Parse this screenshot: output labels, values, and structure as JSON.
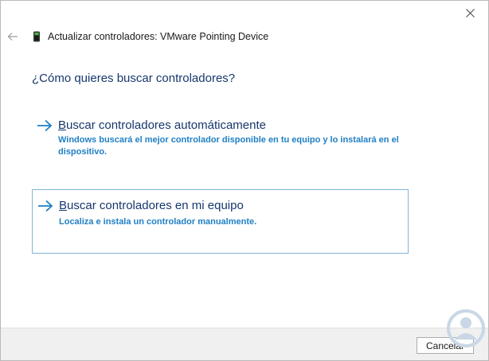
{
  "window": {
    "title": "Actualizar controladores: VMware Pointing Device"
  },
  "heading": "¿Cómo quieres buscar controladores?",
  "options": [
    {
      "title_first": "B",
      "title_rest": "uscar controladores automáticamente",
      "description": "Windows buscará el mejor controlador disponible en tu equipo y lo instalará en el dispositivo."
    },
    {
      "title_first": "B",
      "title_rest": "uscar controladores en mi equipo",
      "description": "Localiza e instala un controlador manualmente."
    }
  ],
  "footer": {
    "cancel_label": "Cancelar"
  },
  "colors": {
    "accent": "#1f7fc4",
    "heading": "#17376d",
    "selection_border": "#7fb4d8",
    "watermark": "#c9d7e6"
  },
  "icons": {
    "back": "back-arrow-icon",
    "device": "pointing-device-icon",
    "close": "close-icon",
    "option_arrow": "arrow-right-icon",
    "watermark": "watermark-logo-icon"
  }
}
